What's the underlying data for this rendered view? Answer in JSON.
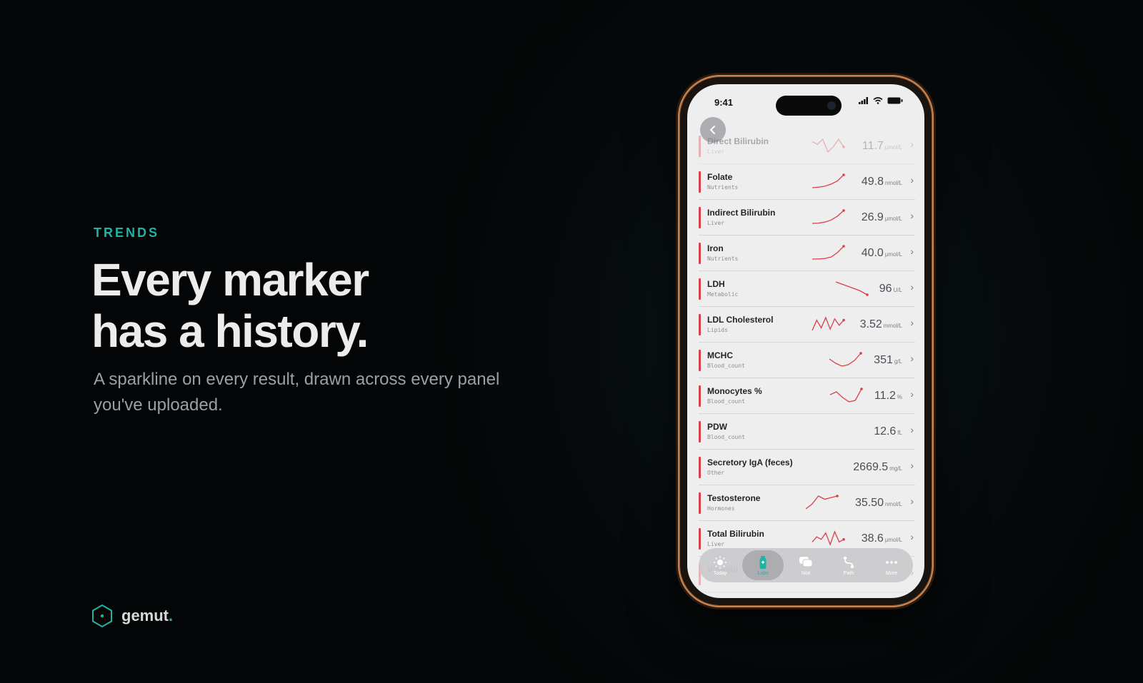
{
  "hero": {
    "eyebrow": "TRENDS",
    "headline_line1": "Every marker",
    "headline_line2": "has a history.",
    "subhead": "A sparkline on every result, drawn across every panel you've uploaded."
  },
  "brand": {
    "name": "gemut",
    "dot": ".",
    "accent": "#1fb3a6"
  },
  "phone": {
    "status": {
      "time": "9:41"
    },
    "markers": [
      {
        "name": "Direct Bilirubin",
        "category": "Liver",
        "value": "11.7",
        "unit": "μmol/L",
        "trend": [
          5,
          4,
          6,
          1,
          3,
          6,
          3
        ]
      },
      {
        "name": "Folate",
        "category": "Nutrients",
        "value": "49.8",
        "unit": "nmol/L",
        "trend": [
          1,
          1.2,
          1.6,
          2.4,
          3.6,
          6
        ]
      },
      {
        "name": "Indirect Bilirubin",
        "category": "Liver",
        "value": "26.9",
        "unit": "μmol/L",
        "trend": [
          1,
          1.1,
          1.5,
          2.3,
          3.8,
          6
        ]
      },
      {
        "name": "Iron",
        "category": "Nutrients",
        "value": "40.0",
        "unit": "μmol/L",
        "trend": [
          1,
          1.05,
          1.2,
          1.8,
          3.5,
          6
        ]
      },
      {
        "name": "LDH",
        "category": "Metabolic",
        "value": "96",
        "unit": "U/L",
        "trend": [
          6,
          5,
          4,
          3,
          1.5
        ]
      },
      {
        "name": "LDL Cholesterol",
        "category": "Lipids",
        "value": "3.52",
        "unit": "mmol/L",
        "trend": [
          1,
          5,
          2,
          6,
          1.5,
          5.5,
          3,
          5
        ]
      },
      {
        "name": "MCHC",
        "category": "Blood_count",
        "value": "351",
        "unit": "g/L",
        "trend": [
          4,
          2.5,
          1.5,
          2,
          3.5,
          6
        ]
      },
      {
        "name": "Monocytes %",
        "category": "Blood_count",
        "value": "11.2",
        "unit": "%",
        "trend": [
          4,
          5,
          3,
          1.5,
          2,
          6
        ]
      },
      {
        "name": "PDW",
        "category": "Blood_count",
        "value": "12.6",
        "unit": "fL",
        "trend": []
      },
      {
        "name": "Secretory IgA (feces)",
        "category": "Other",
        "value": "2669.5",
        "unit": "mg/L",
        "trend": []
      },
      {
        "name": "Testosterone",
        "category": "Hormones",
        "value": "35.50",
        "unit": "nmol/L",
        "trend": [
          1,
          2.5,
          5,
          4,
          4.5,
          5
        ]
      },
      {
        "name": "Total Bilirubin",
        "category": "Liver",
        "value": "38.6",
        "unit": "μmol/L",
        "trend": [
          2,
          4,
          3,
          5.5,
          1,
          6,
          2,
          3
        ]
      },
      {
        "name": "Vitamin",
        "category": "",
        "value": "",
        "unit": "",
        "trend": []
      }
    ],
    "tabs": [
      {
        "label": "Today",
        "icon": "sun-icon"
      },
      {
        "label": "Labs",
        "icon": "vial-icon"
      },
      {
        "label": "Noa",
        "icon": "chat-icon"
      },
      {
        "label": "Path",
        "icon": "path-icon"
      },
      {
        "label": "More",
        "icon": "more-icon"
      }
    ],
    "active_tab": "Labs",
    "spark_color": "#d9404a"
  }
}
